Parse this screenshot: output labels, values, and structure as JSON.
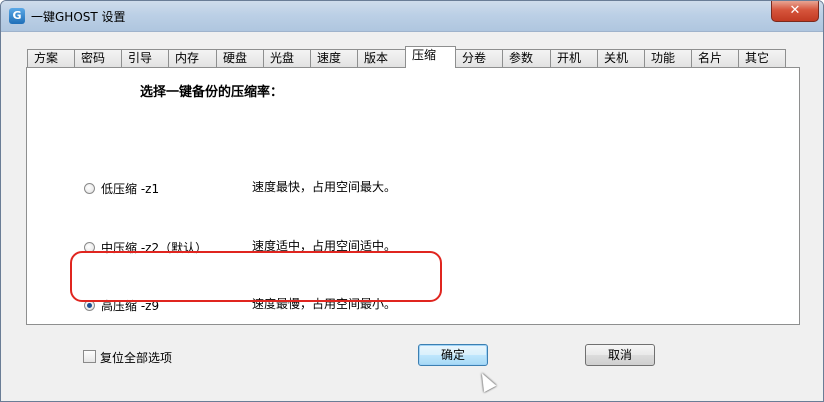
{
  "window": {
    "title": "一键GHOST 设置",
    "app_icon": "G",
    "close_glyph": "✕"
  },
  "tabs": [
    {
      "label": "方案",
      "active": false
    },
    {
      "label": "密码",
      "active": false
    },
    {
      "label": "引导",
      "active": false
    },
    {
      "label": "内存",
      "active": false
    },
    {
      "label": "硬盘",
      "active": false
    },
    {
      "label": "光盘",
      "active": false
    },
    {
      "label": "速度",
      "active": false
    },
    {
      "label": "版本",
      "active": false
    },
    {
      "label": "压缩",
      "active": true
    },
    {
      "label": "分卷",
      "active": false
    },
    {
      "label": "参数",
      "active": false
    },
    {
      "label": "开机",
      "active": false
    },
    {
      "label": "关机",
      "active": false
    },
    {
      "label": "功能",
      "active": false
    },
    {
      "label": "名片",
      "active": false
    },
    {
      "label": "其它",
      "active": false
    }
  ],
  "compression": {
    "heading": "选择一键备份的压缩率：",
    "options": [
      {
        "label": "低压缩 -z1",
        "description": "速度最快，占用空间最大。",
        "selected": false
      },
      {
        "label": "中压缩 -z2（默认）",
        "description": "速度适中，占用空间适中。",
        "selected": false
      },
      {
        "label": "高压缩 -z9",
        "description": "速度最慢，占用空间最小。",
        "selected": true
      }
    ]
  },
  "footer": {
    "reset_label": "复位全部选项",
    "reset_checked": false,
    "ok_label": "确定",
    "cancel_label": "取消"
  },
  "colors": {
    "highlight": "#e0251f",
    "accent": "#3c7fb1"
  }
}
